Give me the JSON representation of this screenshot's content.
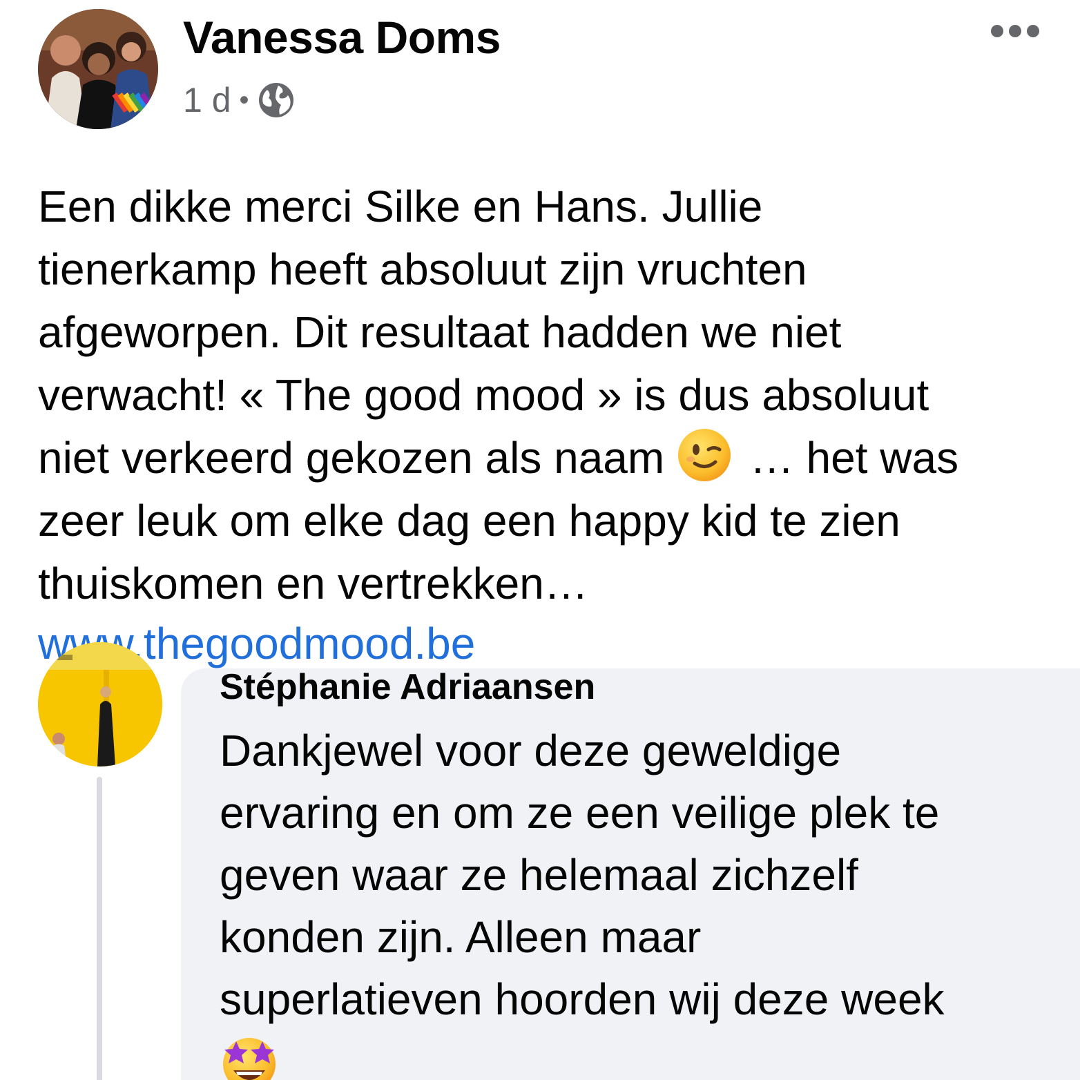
{
  "post": {
    "author": "Vanessa Doms",
    "timestamp": "1 d",
    "separator": "•",
    "audience_icon": "globe-icon",
    "more_icon": "more-options-icon",
    "body_lines": [
      "Een dikke merci Silke en Hans. Jullie",
      "tienerkamp heeft absoluut zijn vruchten",
      "afgeworpen. Dit resultaat hadden we niet",
      "verwacht! « The good mood » is dus absoluut",
      "niet verkeerd gekozen als naam",
      " … het was",
      "zeer leuk om elke dag een happy kid te zien",
      "thuiskomen en vertrekken…"
    ],
    "emoji": "winking-face-icon",
    "link": "www.thegoodmood.be"
  },
  "comment": {
    "author": "Stéphanie Adriaansen",
    "lines": [
      "Dankjewel voor deze geweldige",
      "ervaring en om ze een veilige plek te",
      "geven waar ze helemaal zichzelf",
      "konden zijn. Alleen maar",
      "superlatieven hoorden wij deze week"
    ],
    "emoji": "star-struck-icon"
  },
  "colors": {
    "text": "#050505",
    "meta": "#65676b",
    "link": "#216fdb",
    "bubble": "#f0f2f5"
  }
}
